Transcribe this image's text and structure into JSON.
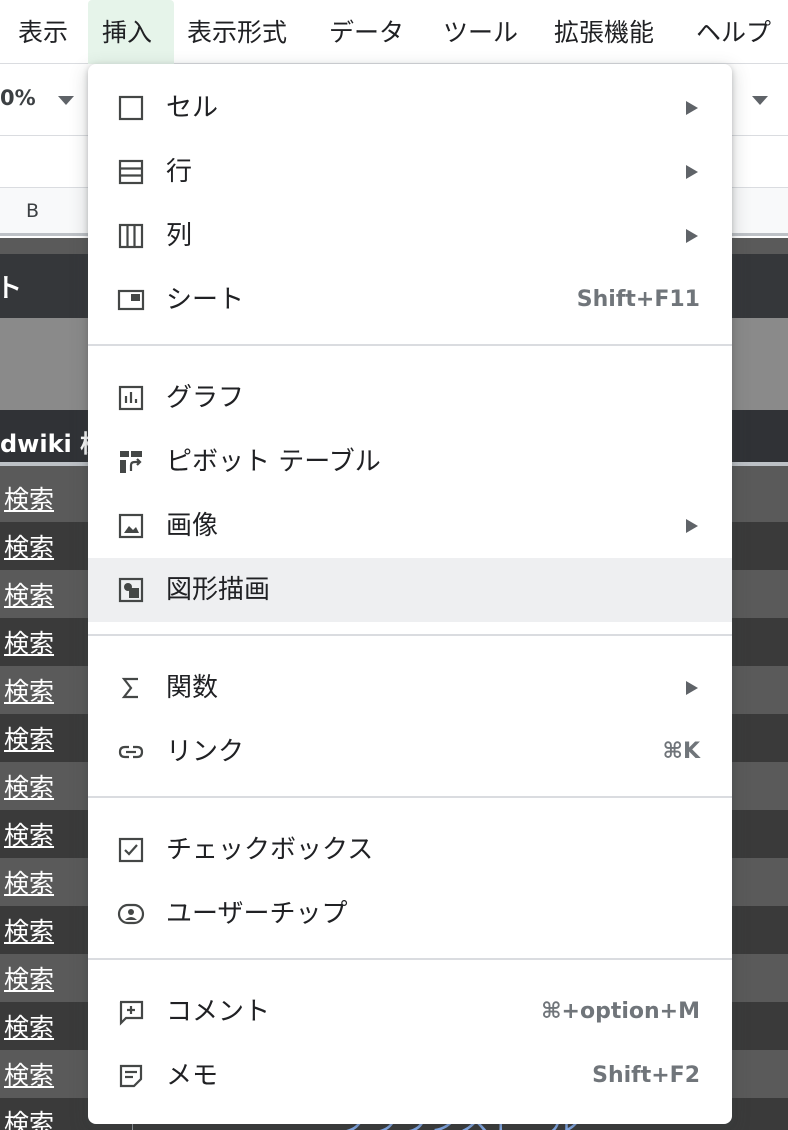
{
  "menubar": {
    "items": [
      "表示",
      "挿入",
      "表示形式",
      "データ",
      "ツール",
      "拡張機能",
      "ヘルプ"
    ],
    "active": "挿入"
  },
  "toolbar": {
    "zoom": "0%"
  },
  "column_header": {
    "b": "B"
  },
  "sheet": {
    "title_cell": "ト",
    "header_cell": "dwiki 検",
    "link_text": "検索",
    "underlay_text": "ブラウンストール"
  },
  "insert_menu": {
    "groups": [
      [
        {
          "label": "セル",
          "icon": "cell-icon",
          "shortcut": "",
          "submenu": true
        },
        {
          "label": "行",
          "icon": "row-icon",
          "shortcut": "",
          "submenu": true
        },
        {
          "label": "列",
          "icon": "column-icon",
          "shortcut": "",
          "submenu": true
        },
        {
          "label": "シート",
          "icon": "sheet-icon",
          "shortcut": "Shift+F11",
          "submenu": false
        }
      ],
      [
        {
          "label": "グラフ",
          "icon": "chart-icon",
          "shortcut": "",
          "submenu": false
        },
        {
          "label": "ピボット テーブル",
          "icon": "pivot-table-icon",
          "shortcut": "",
          "submenu": false
        },
        {
          "label": "画像",
          "icon": "image-icon",
          "shortcut": "",
          "submenu": true
        },
        {
          "label": "図形描画",
          "icon": "drawing-icon",
          "shortcut": "",
          "submenu": false,
          "highlighted": true
        }
      ],
      [
        {
          "label": "関数",
          "icon": "sigma-icon",
          "shortcut": "",
          "submenu": true
        },
        {
          "label": "リンク",
          "icon": "link-icon",
          "shortcut": "⌘K",
          "submenu": false
        }
      ],
      [
        {
          "label": "チェックボックス",
          "icon": "checkbox-icon",
          "shortcut": "",
          "submenu": false
        },
        {
          "label": "ユーザーチップ",
          "icon": "person-chip-icon",
          "shortcut": "",
          "submenu": false
        }
      ],
      [
        {
          "label": "コメント",
          "icon": "comment-icon",
          "shortcut": "⌘+option+M",
          "submenu": false
        },
        {
          "label": "メモ",
          "icon": "note-icon",
          "shortcut": "Shift+F2",
          "submenu": false
        }
      ]
    ]
  },
  "colors": {
    "menu_bg": "#ffffff",
    "hover_bg": "#eeeff1",
    "active_menu_bg": "#e6f4ea",
    "text": "#202124",
    "shortcut_text": "#70757a",
    "grid_dark": "#3a3a3a",
    "grid_mid": "#5a5a5a",
    "header_row": "#303236"
  }
}
